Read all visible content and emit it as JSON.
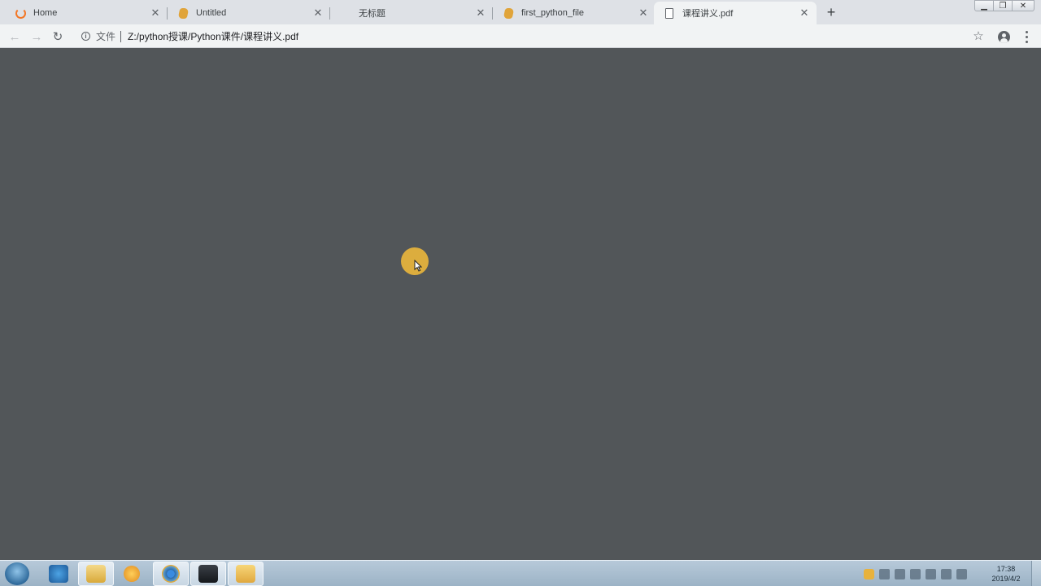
{
  "browser": {
    "tabs": [
      {
        "title": "Home",
        "icon": "jupyter-logo-icon",
        "active": false
      },
      {
        "title": "Untitled",
        "icon": "notebook-icon",
        "active": false
      },
      {
        "title": "无标题",
        "icon": "",
        "active": false
      },
      {
        "title": "first_python_file",
        "icon": "notebook-icon",
        "active": false
      },
      {
        "title": "课程讲义.pdf",
        "icon": "document-icon",
        "active": true
      }
    ],
    "toolbar": {
      "scheme_label": "文件",
      "url": "Z:/python授课/Python课件/课程讲义.pdf"
    }
  },
  "taskbar": {
    "clock_time": "17:38",
    "clock_date": "2019/4/2"
  },
  "colors": {
    "viewer_bg": "#525659",
    "cursor_highlight": "#e8b43c"
  }
}
